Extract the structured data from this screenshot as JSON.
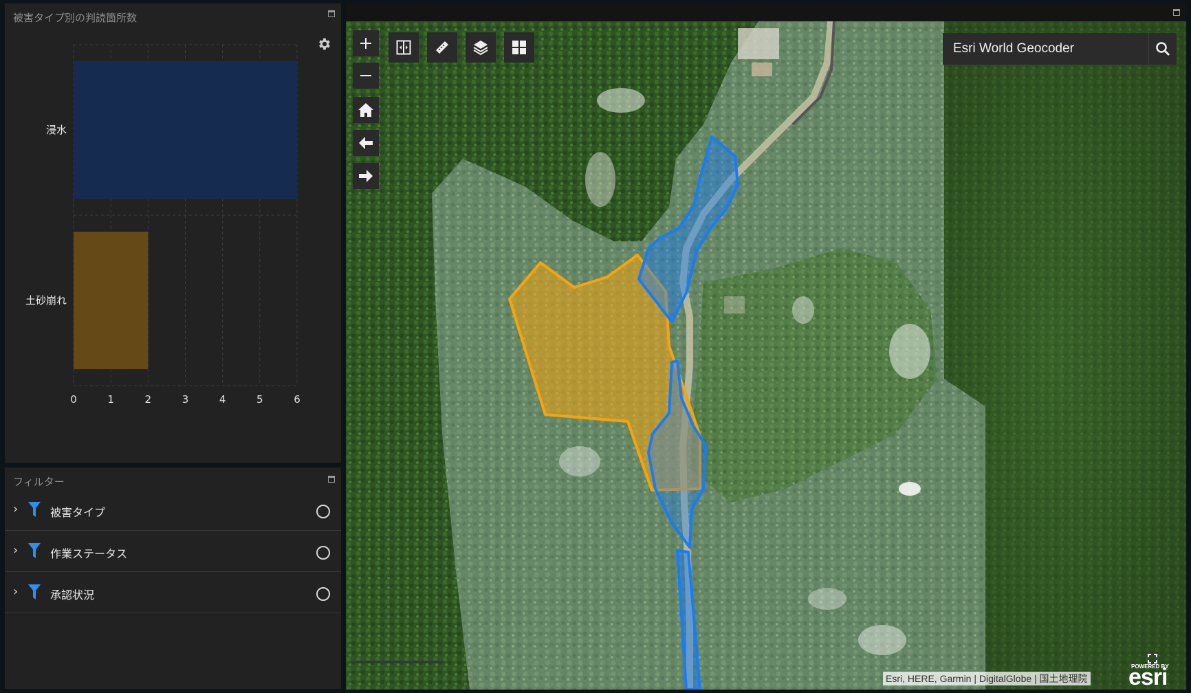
{
  "chart_panel": {
    "title": "被害タイプ別の判読箇所数"
  },
  "chart_data": {
    "type": "bar",
    "orientation": "horizontal",
    "categories": [
      "浸水",
      "土砂崩れ"
    ],
    "values": [
      6,
      2
    ],
    "colors": [
      "#162b50",
      "#654a18"
    ],
    "xlim": [
      0,
      6
    ],
    "xticks": [
      "0",
      "1",
      "2",
      "3",
      "4",
      "5",
      "6"
    ],
    "grid": true
  },
  "filter_panel": {
    "title": "フィルター",
    "items": [
      {
        "label": "被害タイプ"
      },
      {
        "label": "作業ステータス"
      },
      {
        "label": "承認状況"
      }
    ]
  },
  "map": {
    "toolbar": [
      {
        "icon": "split-view-icon"
      },
      {
        "icon": "measure-icon"
      },
      {
        "icon": "layers-icon"
      },
      {
        "icon": "basemap-gallery-icon"
      }
    ],
    "nav_buttons": [
      {
        "icon": "zoom-in-icon"
      },
      {
        "icon": "zoom-out-icon"
      },
      {
        "icon": "home-icon"
      },
      {
        "icon": "previous-extent-icon"
      },
      {
        "icon": "next-extent-icon"
      }
    ],
    "search": {
      "placeholder": "Esri World Geocoder"
    },
    "attribution": "Esri, HERE, Garmin | DigitalGlobe | 国土地理院",
    "logo": {
      "small": "POWERED BY",
      "big": "esri"
    },
    "colors": {
      "flood": "#1a7cf5",
      "landslide": "#f5a40e"
    }
  }
}
